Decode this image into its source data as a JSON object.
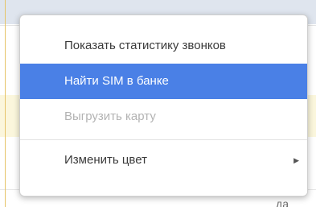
{
  "menu": {
    "items": [
      {
        "label": "Показать статистику звонков"
      },
      {
        "label": "Найти SIM в банке"
      },
      {
        "label": "Выгрузить карту"
      },
      {
        "label": "Изменить цвет",
        "submenu_icon": "chevron-right-icon"
      }
    ]
  },
  "background": {
    "peek_text": "да"
  },
  "colors": {
    "highlight": "#4a80e6",
    "disabled_text": "#b3b3b3"
  }
}
